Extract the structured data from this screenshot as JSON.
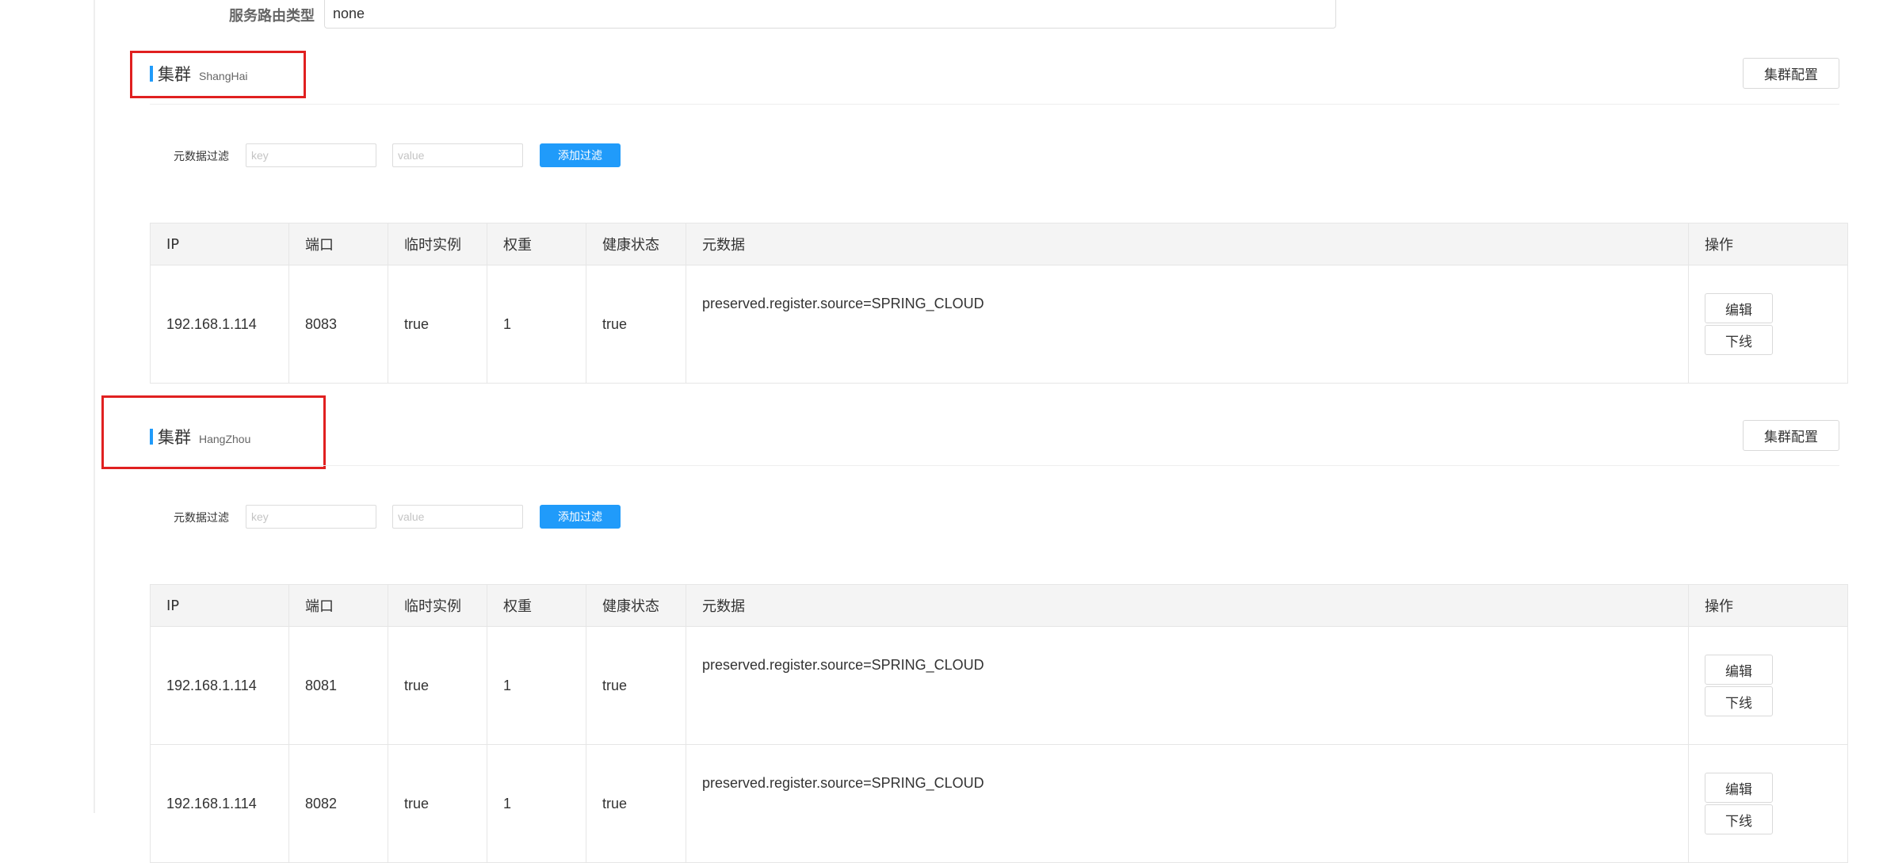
{
  "route": {
    "label": "服务路由类型",
    "value": "none"
  },
  "clusters": [
    {
      "title_word": "集群",
      "name": "ShangHai",
      "config_button": "集群配置",
      "filter": {
        "label": "元数据过滤",
        "key_placeholder": "key",
        "value_placeholder": "value",
        "button": "添加过滤"
      },
      "headers": [
        "IP",
        "端口",
        "临时实例",
        "权重",
        "健康状态",
        "元数据",
        "操作"
      ],
      "rows": [
        {
          "ip": "192.168.1.114",
          "port": "8083",
          "ephemeral": "true",
          "weight": "1",
          "healthy": "true",
          "metadata": "preserved.register.source=SPRING_CLOUD",
          "edit": "编辑",
          "offline": "下线"
        }
      ]
    },
    {
      "title_word": "集群",
      "name": "HangZhou",
      "config_button": "集群配置",
      "filter": {
        "label": "元数据过滤",
        "key_placeholder": "key",
        "value_placeholder": "value",
        "button": "添加过滤"
      },
      "headers": [
        "IP",
        "端口",
        "临时实例",
        "权重",
        "健康状态",
        "元数据",
        "操作"
      ],
      "rows": [
        {
          "ip": "192.168.1.114",
          "port": "8081",
          "ephemeral": "true",
          "weight": "1",
          "healthy": "true",
          "metadata": "preserved.register.source=SPRING_CLOUD",
          "edit": "编辑",
          "offline": "下线"
        },
        {
          "ip": "192.168.1.114",
          "port": "8082",
          "ephemeral": "true",
          "weight": "1",
          "healthy": "true",
          "metadata": "preserved.register.source=SPRING_CLOUD",
          "edit": "编辑",
          "offline": "下线"
        }
      ]
    }
  ],
  "colors": {
    "accent": "#209bfa",
    "highlight_box": "#e02020"
  }
}
